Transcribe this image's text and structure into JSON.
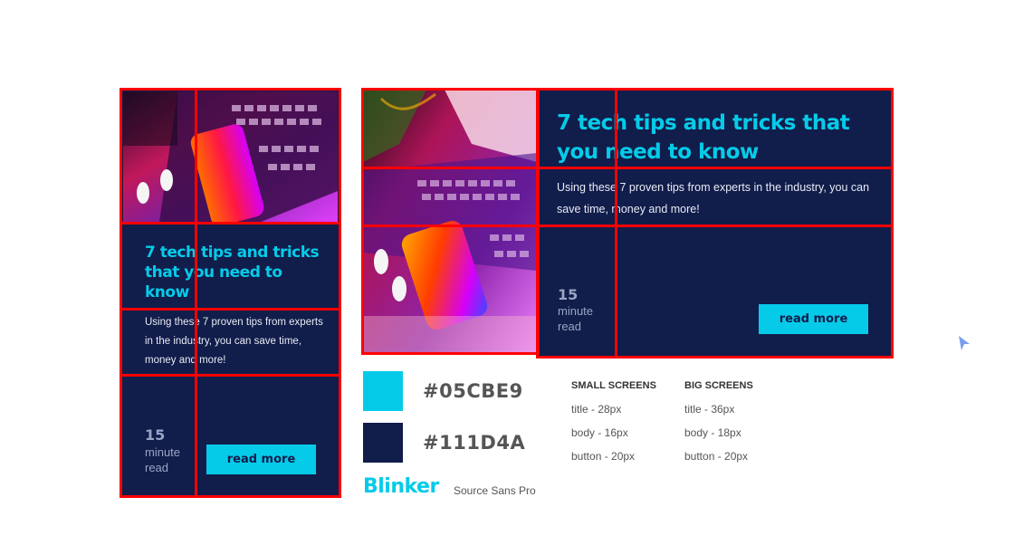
{
  "colors": {
    "accent": "#05CBE9",
    "navy": "#111D4A",
    "highlight": "#ff0000"
  },
  "card_small": {
    "title": "7 tech tips and tricks that you need to know",
    "body": "Using these 7 proven tips from experts in the industry, you can save time, money and more!",
    "read_num": "15",
    "read_word1": "minute",
    "read_word2": "read",
    "button": "read more"
  },
  "card_big": {
    "title": "7 tech tips and tricks that you need to know",
    "body": "Using these 7 proven tips from experts in the industry, you can save time, money and more!",
    "read_num": "15",
    "read_word1": "minute",
    "read_word2": "read",
    "button": "read more"
  },
  "palette": {
    "swatches": [
      {
        "hex": "#05CBE9"
      },
      {
        "hex": "#111D4A"
      }
    ]
  },
  "fonts": {
    "heading": "Blinker",
    "body": "Source Sans Pro"
  },
  "specs": {
    "small": {
      "heading": "SMALL SCREENS",
      "rows": [
        "title - 28px",
        "body - 16px",
        "button - 20px"
      ]
    },
    "big": {
      "heading": "BIG SCREENS",
      "rows": [
        "title - 36px",
        "body - 18px",
        "button - 20px"
      ]
    }
  },
  "cursor_icon": "cursor-arrow-icon"
}
